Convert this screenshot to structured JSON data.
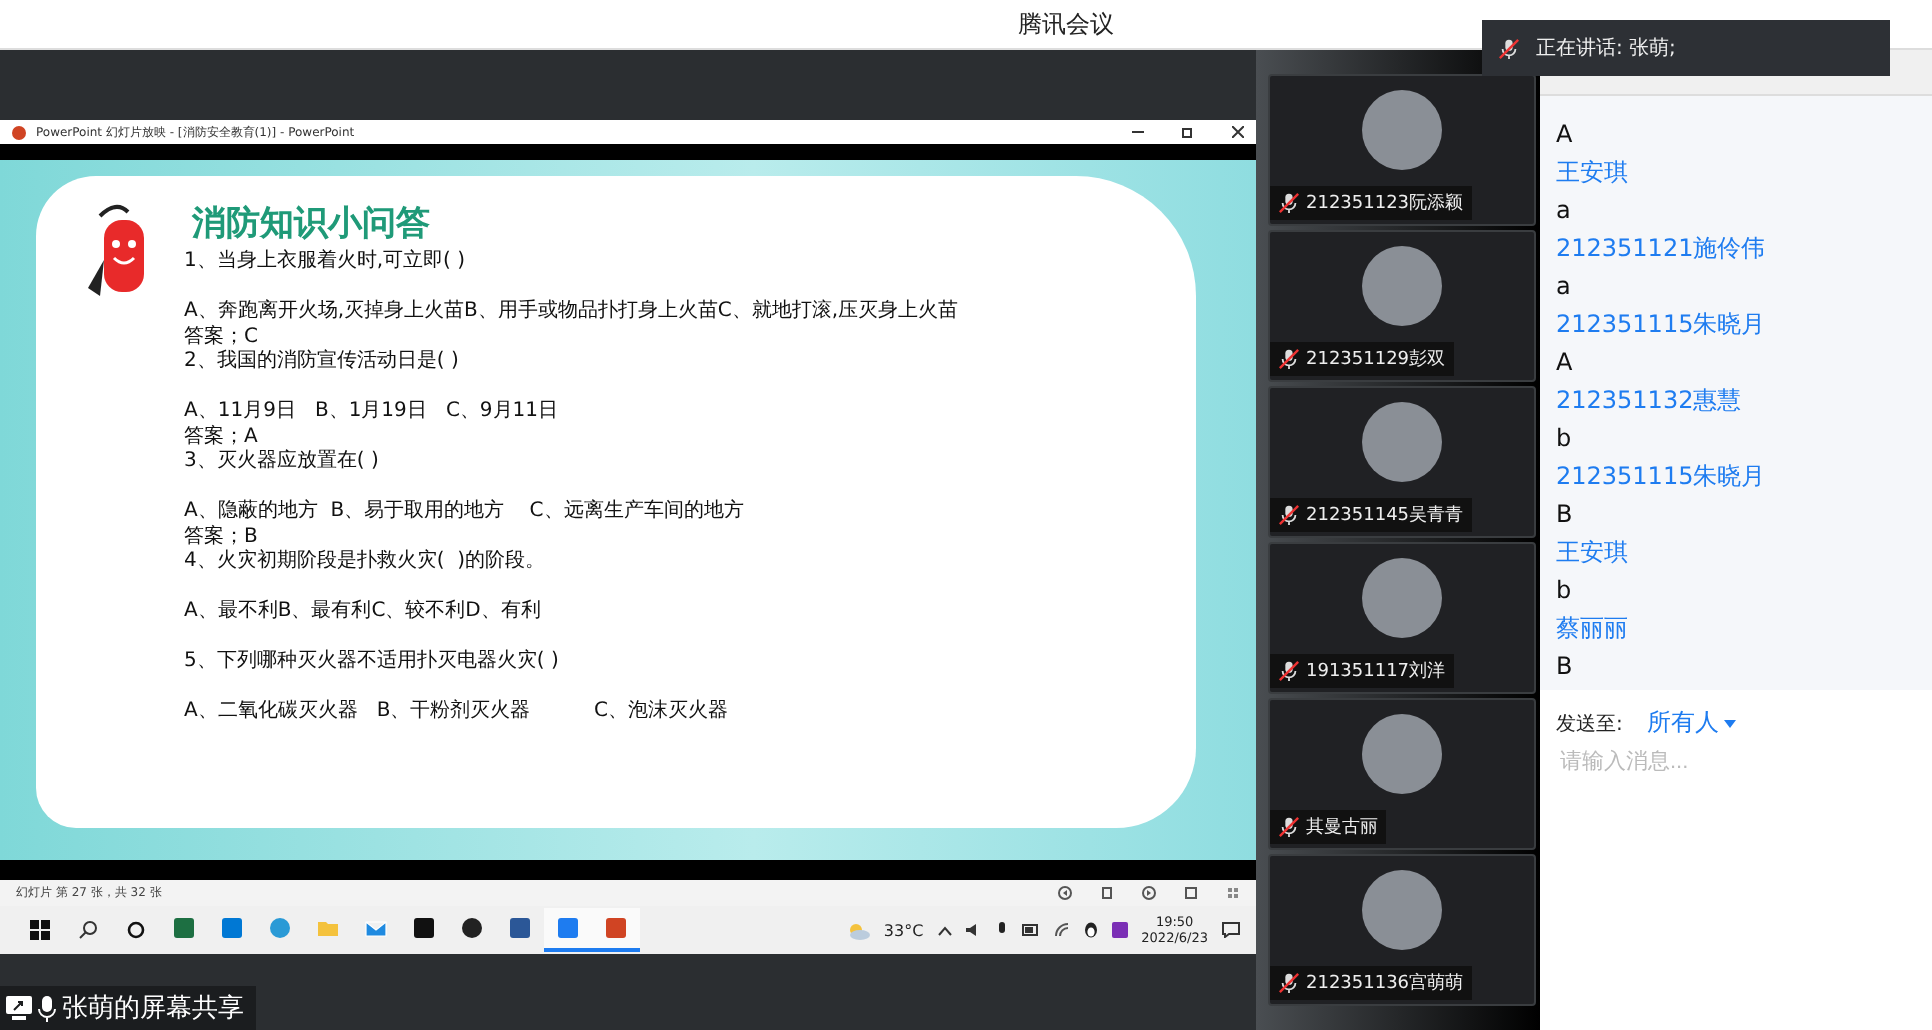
{
  "window": {
    "title": "腾讯会议"
  },
  "speaker_toast": {
    "text": "正在讲话: 张萌;"
  },
  "ppt_window": {
    "title": "PowerPoint 幻灯片放映 - [消防安全教育(1)] - PowerPoint"
  },
  "slide": {
    "title": "消防知识小问答",
    "questions": [
      {
        "question": "1、当身上衣服着火时,可立即( )",
        "options": "A、奔跑离开火场,灭掉身上火苗B、用手或物品扑打身上火苗C、就地打滚,压灭身上火苗",
        "answer": "答案；C"
      },
      {
        "question": "2、我国的消防宣传活动日是( )",
        "options": "A、11月9日   B、1月19日   C、9月11日",
        "answer": "答案；A"
      },
      {
        "question": "3、灭火器应放置在( )",
        "options": "A、隐蔽的地方  B、易于取用的地方    C、远离生产车间的地方",
        "answer": "答案；B"
      },
      {
        "question": "4、火灾初期阶段是扑救火灾(  )的阶段。",
        "options": "A、最不利B、最有利C、较不利D、有利"
      },
      {
        "question": "5、下列哪种灭火器不适用扑灭电器火灾( )",
        "options": "A、二氧化碳灭火器   B、干粉剂灭火器          C、泡沫灭火器"
      }
    ]
  },
  "ppt_status": {
    "text": "幻灯片 第 27 张，共 32 张"
  },
  "taskbar": {
    "weather": "33°C",
    "time": "19:50",
    "date": "2022/6/23",
    "apps": [
      {
        "kind": "excel",
        "color": "#1d6f42",
        "active": false
      },
      {
        "kind": "store",
        "color": "#0078d4",
        "active": false
      },
      {
        "kind": "edge",
        "color": "#2a9ad6",
        "active": false
      },
      {
        "kind": "folder",
        "color": "#f4c23d",
        "active": false
      },
      {
        "kind": "mail",
        "color": "#1f8ae0",
        "active": false
      },
      {
        "kind": "tiktok",
        "color": "#111111",
        "active": false
      },
      {
        "kind": "qq",
        "color": "#222222",
        "active": false
      },
      {
        "kind": "word",
        "color": "#2b5797",
        "active": false
      },
      {
        "kind": "meeting",
        "color": "#1e7cf0",
        "active": true
      },
      {
        "kind": "powerpoint",
        "color": "#d04423",
        "active": true
      }
    ]
  },
  "share_label": {
    "text": "张萌的屏幕共享"
  },
  "participants": [
    {
      "name": "212351123阮添颖",
      "muted": true
    },
    {
      "name": "212351129彭双",
      "muted": true
    },
    {
      "name": "212351145吴青青",
      "muted": true
    },
    {
      "name": "191351117刘洋",
      "muted": true
    },
    {
      "name": "其曼古丽",
      "muted": true
    },
    {
      "name": "212351136宫萌萌",
      "muted": true
    }
  ],
  "chat": {
    "messages": [
      {
        "text": "A"
      },
      {
        "sender": "王安琪",
        "text": "a"
      },
      {
        "sender": "212351121施伶伟",
        "text": "a"
      },
      {
        "sender": "212351115朱晓月",
        "text": "A"
      },
      {
        "sender": "212351132惠慧",
        "text": "b"
      },
      {
        "sender": "212351115朱晓月",
        "text": "B"
      },
      {
        "sender": "王安琪",
        "text": "b"
      },
      {
        "sender": "蔡丽丽",
        "text": "B"
      }
    ],
    "send_to_label": "发送至:",
    "send_to_value": "所有人",
    "placeholder": "请输入消息..."
  }
}
